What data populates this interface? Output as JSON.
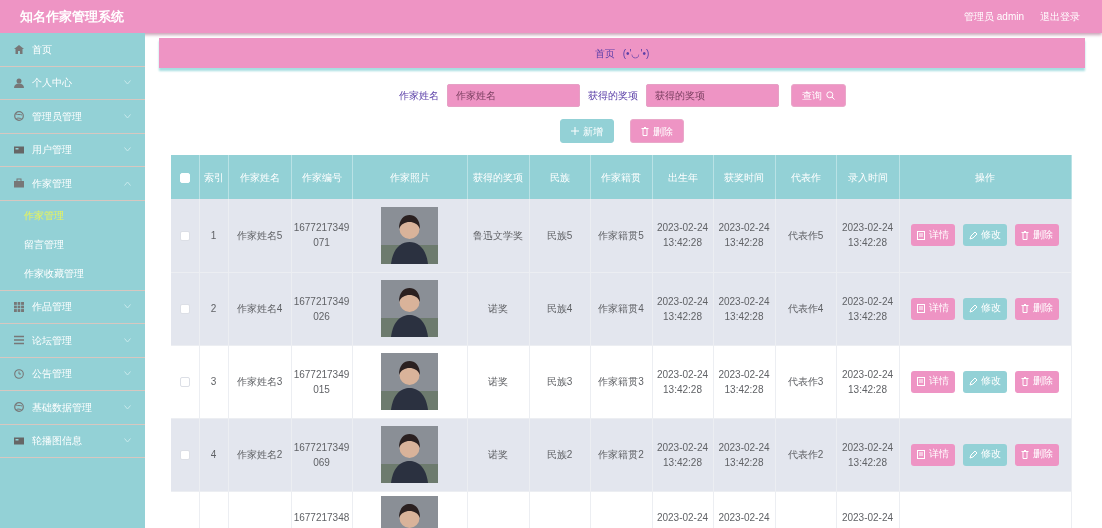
{
  "header": {
    "title": "知名作家管理系统",
    "user": "管理员 admin",
    "logout": "退出登录"
  },
  "sidebar": {
    "items": [
      {
        "label": "首页",
        "expandable": false
      },
      {
        "label": "个人中心",
        "expandable": true,
        "expanded": false
      },
      {
        "label": "管理员管理",
        "expandable": true,
        "expanded": false
      },
      {
        "label": "用户管理",
        "expandable": true,
        "expanded": false
      },
      {
        "label": "作家管理",
        "expandable": true,
        "expanded": true,
        "children": [
          {
            "label": "作家管理",
            "selected": true
          },
          {
            "label": "留言管理",
            "selected": false
          },
          {
            "label": "作家收藏管理",
            "selected": false
          }
        ]
      },
      {
        "label": "作品管理",
        "expandable": true,
        "expanded": false
      },
      {
        "label": "论坛管理",
        "expandable": true,
        "expanded": false
      },
      {
        "label": "公告管理",
        "expandable": true,
        "expanded": false
      },
      {
        "label": "基础数据管理",
        "expandable": true,
        "expanded": false
      },
      {
        "label": "轮播图信息",
        "expandable": true,
        "expanded": false
      }
    ]
  },
  "breadcrumb": {
    "home": "首页",
    "emoticon": "(•'◡'•)"
  },
  "search": {
    "fields": [
      {
        "label": "作家姓名",
        "placeholder": "作家姓名"
      },
      {
        "label": "获得的奖项",
        "placeholder": "获得的奖项"
      }
    ],
    "button": "查询"
  },
  "actions": {
    "add": "新增",
    "delete": "删除"
  },
  "table": {
    "header_checked": false,
    "columns": [
      "索引",
      "作家姓名",
      "作家编号",
      "作家照片",
      "获得的奖项",
      "民族",
      "作家籍贯",
      "出生年",
      "获奖时间",
      "代表作",
      "录入时间",
      "操作"
    ],
    "rows": [
      {
        "checked": false,
        "shaded": true,
        "index": "1",
        "name": "作家姓名5",
        "number": "1677217349071",
        "award": "鲁迅文学奖",
        "ethnicity": "民族5",
        "hometown": "作家籍贯5",
        "birth": "2023-02-24 13:42:28",
        "award_time": "2023-02-24 13:42:28",
        "work": "代表作5",
        "entry_time": "2023-02-24 13:42:28",
        "photo": {
          "kind": "picture"
        },
        "buttons": [
          "详情",
          "修改",
          "删除"
        ]
      },
      {
        "checked": false,
        "shaded": true,
        "index": "2",
        "name": "作家姓名4",
        "number": "1677217349026",
        "award": "诺奖",
        "ethnicity": "民族4",
        "hometown": "作家籍贯4",
        "birth": "2023-02-24 13:42:28",
        "award_time": "2023-02-24 13:42:28",
        "work": "代表作4",
        "entry_time": "2023-02-24 13:42:28",
        "photo": {
          "kind": "picture"
        },
        "buttons": [
          "详情",
          "修改",
          "删除"
        ]
      },
      {
        "checked": false,
        "shaded": false,
        "index": "3",
        "name": "作家姓名3",
        "number": "1677217349015",
        "award": "诺奖",
        "ethnicity": "民族3",
        "hometown": "作家籍贯3",
        "birth": "2023-02-24 13:42:28",
        "award_time": "2023-02-24 13:42:28",
        "work": "代表作3",
        "entry_time": "2023-02-24 13:42:28",
        "photo": {
          "kind": "picture"
        },
        "buttons": [
          "详情",
          "修改",
          "删除"
        ]
      },
      {
        "checked": false,
        "shaded": true,
        "index": "4",
        "name": "作家姓名2",
        "number": "1677217349069",
        "award": "诺奖",
        "ethnicity": "民族2",
        "hometown": "作家籍贯2",
        "birth": "2023-02-24 13:42:28",
        "award_time": "2023-02-24 13:42:28",
        "work": "代表作2",
        "entry_time": "2023-02-24 13:42:28",
        "photo": {
          "kind": "picture"
        },
        "buttons": [
          "详情",
          "修改",
          "删除"
        ]
      }
    ],
    "partial_row": {
      "number": "1677217348",
      "birth": "2023-02-24",
      "award_time": "2023-02-24",
      "entry_time": "2023-02-24",
      "photo": {
        "kind": "picture"
      }
    }
  }
}
